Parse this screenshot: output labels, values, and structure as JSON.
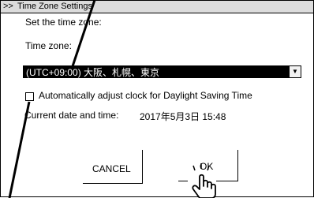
{
  "window": {
    "chevron": ">>",
    "title": "Time Zone Settings"
  },
  "form": {
    "instruction": "Set the time zone:",
    "timezone_label": "Time zone:",
    "timezone_value": "(UTC+09:00) 大阪、札幌、東京",
    "dst_checkbox_label": "Automatically adjust clock for Daylight Saving Time",
    "dst_checked": false,
    "current_label": "Current date and time:",
    "current_value": "2017年5月3日 15:48"
  },
  "buttons": {
    "cancel": "CANCEL",
    "ok": "OK"
  },
  "icons": {
    "dropdown": "dropdown-arrow-icon",
    "pointer": "hand-pointer-icon"
  }
}
